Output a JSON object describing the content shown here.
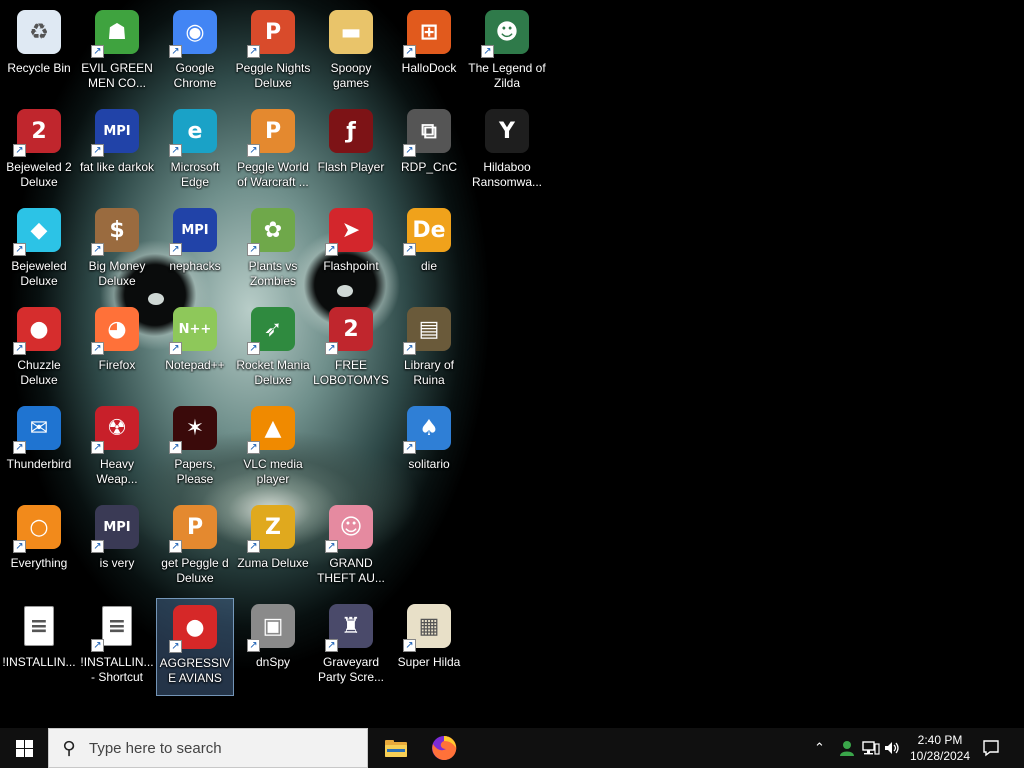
{
  "desktop": {
    "icons": [
      {
        "id": "recycle-bin",
        "label": "Recycle Bin",
        "icon": "recycle-bin-icon",
        "shortcut": false,
        "color": "#dfe9f3"
      },
      {
        "id": "evil-green-men",
        "label": "EVIL GREEN MEN CO...",
        "icon": "green-people-icon",
        "shortcut": true,
        "color": "#3fa33f"
      },
      {
        "id": "google-chrome",
        "label": "Google Chrome",
        "icon": "chrome-icon",
        "shortcut": true,
        "color": "#4285f4"
      },
      {
        "id": "peggle-nights",
        "label": "Peggle Nights Deluxe",
        "icon": "peggle-nights-icon",
        "shortcut": true,
        "color": "#d94b2b"
      },
      {
        "id": "spoopy-games",
        "label": "Spoopy games",
        "icon": "folder-icon",
        "shortcut": false,
        "color": "#e9c46a"
      },
      {
        "id": "hallodock",
        "label": "HalloDock",
        "icon": "windows-shield-icon",
        "shortcut": true,
        "color": "#e15a1d"
      },
      {
        "id": "legend-of-zilda",
        "label": "The Legend of Zilda",
        "icon": "pixel-hero-icon",
        "shortcut": true,
        "color": "#2f7a4a"
      },
      {
        "id": "bejeweled-2",
        "label": "Bejeweled 2 Deluxe",
        "icon": "bejeweled2-icon",
        "shortcut": true,
        "color": "#c0262d"
      },
      {
        "id": "fat-like-darkok",
        "label": "fat like darkok",
        "icon": "mpi-icon",
        "shortcut": true,
        "color": "#2143a8"
      },
      {
        "id": "microsoft-edge",
        "label": "Microsoft Edge",
        "icon": "edge-icon",
        "shortcut": true,
        "color": "#1aa2c7"
      },
      {
        "id": "peggle-world-warcraft",
        "label": "Peggle World of Warcraft ...",
        "icon": "peggle-icon",
        "shortcut": true,
        "color": "#e4892f"
      },
      {
        "id": "flash-player",
        "label": "Flash Player",
        "icon": "flash-icon",
        "shortcut": false,
        "color": "#7d1316"
      },
      {
        "id": "rdp-cnc",
        "label": "RDP_CnC",
        "icon": "remote-desktop-icon",
        "shortcut": true,
        "color": "#555555"
      },
      {
        "id": "hildaboo",
        "label": "Hildaboo Ransomwa...",
        "icon": "yashma-shield-icon",
        "shortcut": false,
        "color": "#1e1e1e"
      },
      {
        "id": "bejeweled",
        "label": "Bejeweled Deluxe",
        "icon": "diamond-icon",
        "shortcut": true,
        "color": "#2cc3e6"
      },
      {
        "id": "big-money",
        "label": "Big Money Deluxe",
        "icon": "money-bag-icon",
        "shortcut": true,
        "color": "#9a6b3f"
      },
      {
        "id": "nephacks",
        "label": "nephacks",
        "icon": "mpi-icon",
        "shortcut": true,
        "color": "#2143a8"
      },
      {
        "id": "plants-vs-zombies",
        "label": "Plants vs Zombies",
        "icon": "flower-icon",
        "shortcut": true,
        "color": "#6fa84a"
      },
      {
        "id": "flashpoint",
        "label": "Flashpoint",
        "icon": "flashpoint-arrow-icon",
        "shortcut": true,
        "color": "#d3262c"
      },
      {
        "id": "die",
        "label": "die",
        "icon": "de-icon",
        "shortcut": true,
        "color": "#f0a21b"
      },
      {
        "id": "chuzzle",
        "label": "Chuzzle Deluxe",
        "icon": "chuzzle-icon",
        "shortcut": true,
        "color": "#d62d2d"
      },
      {
        "id": "firefox",
        "label": "Firefox",
        "icon": "firefox-icon",
        "shortcut": true,
        "color": "#ff7139"
      },
      {
        "id": "notepad-pp",
        "label": "Notepad++",
        "icon": "notepadpp-icon",
        "shortcut": true,
        "color": "#8ec85a"
      },
      {
        "id": "rocket-mania",
        "label": "Rocket Mania Deluxe",
        "icon": "rocket-icon",
        "shortcut": true,
        "color": "#2f8a3f"
      },
      {
        "id": "free-lobotomys",
        "label": "FREE LOBOTOMYS",
        "icon": "bejeweled2-icon",
        "shortcut": true,
        "color": "#c0262d"
      },
      {
        "id": "library-of-ruina",
        "label": "Library of Ruina",
        "icon": "book-shield-icon",
        "shortcut": true,
        "color": "#6a5a3a"
      },
      {
        "id": "thunderbird",
        "label": "Thunderbird",
        "icon": "thunderbird-icon",
        "shortcut": true,
        "color": "#1f74d1"
      },
      {
        "id": "heavy-weapon",
        "label": "Heavy Weap...",
        "icon": "radiation-icon",
        "shortcut": true,
        "color": "#c8202a"
      },
      {
        "id": "papers-please",
        "label": "Papers, Please",
        "icon": "papers-please-icon",
        "shortcut": true,
        "color": "#3a0a0a"
      },
      {
        "id": "vlc",
        "label": "VLC media player",
        "icon": "vlc-cone-icon",
        "shortcut": true,
        "color": "#f08a00"
      },
      {
        "id": "solitario",
        "label": "solitario",
        "icon": "solitaire-icon",
        "shortcut": true,
        "color": "#2f7fd6"
      },
      {
        "id": "everything",
        "label": "Everything",
        "icon": "magnifier-icon",
        "shortcut": true,
        "color": "#f28a1b"
      },
      {
        "id": "is-very",
        "label": "is very",
        "icon": "mpi-dark-icon",
        "shortcut": true,
        "color": "#3a3a55"
      },
      {
        "id": "get-peggle",
        "label": "get Peggle d Deluxe",
        "icon": "peggle-icon",
        "shortcut": true,
        "color": "#e4892f"
      },
      {
        "id": "zuma",
        "label": "Zuma Deluxe",
        "icon": "zuma-icon",
        "shortcut": true,
        "color": "#e0a91e"
      },
      {
        "id": "gta",
        "label": "GRAND THEFT AU...",
        "icon": "anime-girl-icon",
        "shortcut": true,
        "color": "#e58aa0"
      },
      {
        "id": "installing-1",
        "label": "!INSTALLIN...",
        "icon": "text-document-icon",
        "shortcut": false,
        "color": "#ffffff"
      },
      {
        "id": "installing-shortcut",
        "label": "!INSTALLIN... - Shortcut",
        "icon": "text-document-icon",
        "shortcut": true,
        "color": "#ffffff"
      },
      {
        "id": "aggressive-avians",
        "label": "AGGRESSIVE AVIANS",
        "icon": "angry-bird-icon",
        "shortcut": true,
        "color": "#d62828",
        "selected": true
      },
      {
        "id": "dnspy",
        "label": "dnSpy",
        "icon": "dnspy-icon",
        "shortcut": true,
        "color": "#8a8a8a"
      },
      {
        "id": "graveyard-party",
        "label": "Graveyard Party Scre...",
        "icon": "castle-icon",
        "shortcut": true,
        "color": "#4a4a6a"
      },
      {
        "id": "super-hilda",
        "label": "Super Hilda",
        "icon": "pixel-cat-icon",
        "shortcut": true,
        "color": "#e8e0c8"
      }
    ]
  },
  "taskbar": {
    "search_placeholder": "Type here to search",
    "pinned": [
      {
        "id": "file-explorer",
        "icon": "folder-icon",
        "color": "#f4c542"
      },
      {
        "id": "firefox",
        "icon": "firefox-icon",
        "color": "#ff7139"
      }
    ],
    "tray": {
      "time": "2:40 PM",
      "date": "10/28/2024"
    }
  }
}
